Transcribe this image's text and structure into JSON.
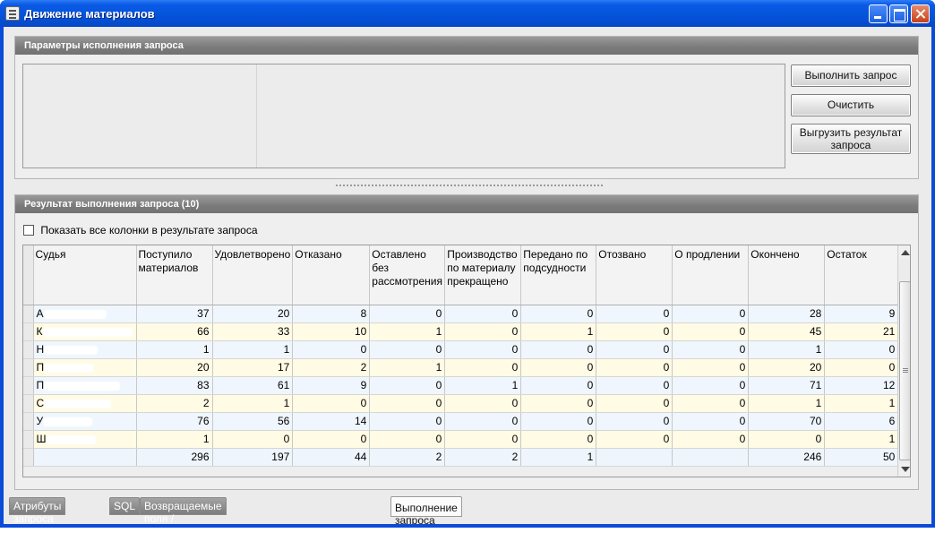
{
  "window": {
    "title": "Движение материалов"
  },
  "params_panel": {
    "title": "Параметры исполнения запроса",
    "buttons": {
      "execute": "Выполнить запрос",
      "clear": "Очистить",
      "export_line1": "Выгрузить результат",
      "export_line2": "запроса"
    }
  },
  "result_panel": {
    "title": "Результат выполнения запроса (10)",
    "show_all_columns_label": "Показать все колонки в результате запроса",
    "show_all_columns_checked": false,
    "columns": [
      "Судья",
      "Поступило материалов",
      "Удовлетворено",
      "Отказано",
      "Оставлено без рассмотрения",
      "Производство по материалу прекращено",
      "Передано по подсудности",
      "Отозвано",
      "О продлении",
      "Окончено",
      "Остаток"
    ],
    "rows": [
      [
        "А",
        "37",
        "20",
        "8",
        "0",
        "0",
        "0",
        "0",
        "0",
        "28",
        "9"
      ],
      [
        "К",
        "66",
        "33",
        "10",
        "1",
        "0",
        "1",
        "0",
        "0",
        "45",
        "21"
      ],
      [
        "Н",
        "1",
        "1",
        "0",
        "0",
        "0",
        "0",
        "0",
        "0",
        "1",
        "0"
      ],
      [
        "П",
        "20",
        "17",
        "2",
        "1",
        "0",
        "0",
        "0",
        "0",
        "20",
        "0"
      ],
      [
        "П",
        "83",
        "61",
        "9",
        "0",
        "1",
        "0",
        "0",
        "0",
        "71",
        "12"
      ],
      [
        "С",
        "2",
        "1",
        "0",
        "0",
        "0",
        "0",
        "0",
        "0",
        "1",
        "1"
      ],
      [
        "У",
        "76",
        "56",
        "14",
        "0",
        "0",
        "0",
        "0",
        "0",
        "70",
        "6"
      ],
      [
        "Ш",
        "1",
        "0",
        "0",
        "0",
        "0",
        "0",
        "0",
        "0",
        "0",
        "1"
      ],
      [
        "",
        "296",
        "197",
        "44",
        "2",
        "2",
        "1",
        "",
        "",
        "246",
        "50"
      ]
    ]
  },
  "tabs": [
    {
      "label": "Атрибуты запроса",
      "active": false
    },
    {
      "label": "SQL",
      "active": false
    },
    {
      "label": "Возвращаемые поля / Параметры исполнения",
      "active": false
    },
    {
      "label": "Выполнение запроса",
      "active": true
    }
  ]
}
